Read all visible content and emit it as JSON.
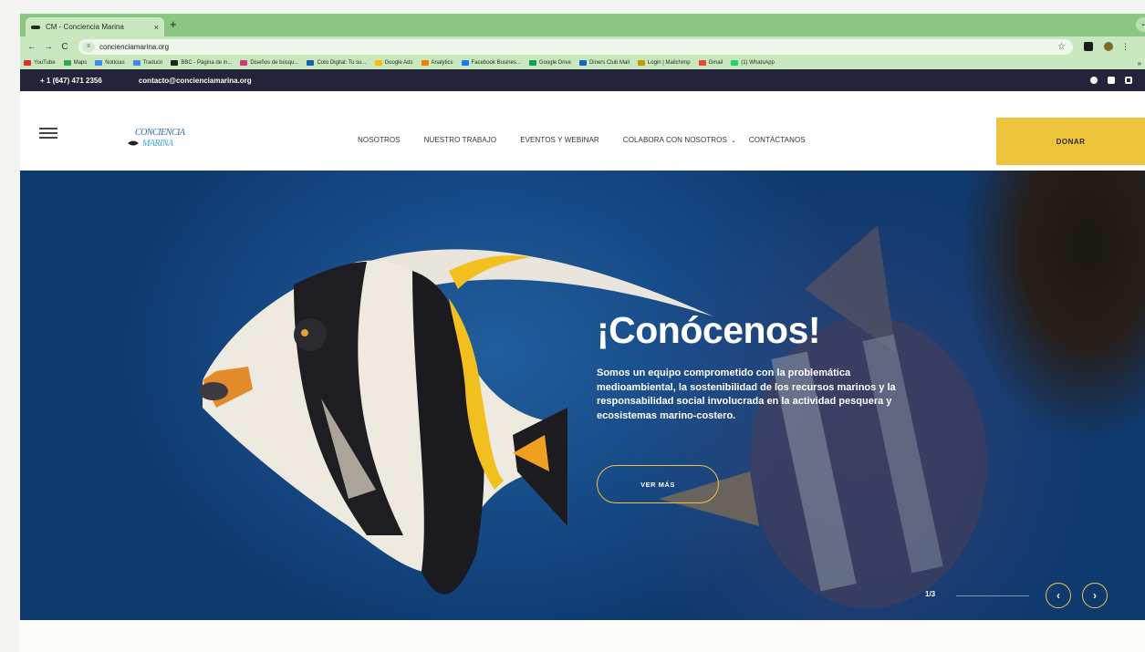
{
  "browser": {
    "tab_title": "CM - Conciencia Marina",
    "tab_close": "×",
    "new_tab": "+",
    "tab_menu": "⌄",
    "nav": {
      "back": "←",
      "forward": "→",
      "reload": "C"
    },
    "url": "concienciamarina.org",
    "site_info_icon": "≡",
    "star": "☆",
    "more": "⋮",
    "bookmarks": [
      {
        "label": "YouTube",
        "icon": "youtube-icon",
        "color": "#e52d27"
      },
      {
        "label": "Maps",
        "icon": "maps-icon",
        "color": "#34a853"
      },
      {
        "label": "Noticias",
        "icon": "news-icon",
        "color": "#4285f4"
      },
      {
        "label": "Traducir",
        "icon": "translate-icon",
        "color": "#4285f4"
      },
      {
        "label": "BBC - Página de in...",
        "icon": "bbc-icon",
        "color": "#222222"
      },
      {
        "label": "Diseños de búsqu...",
        "icon": "design-icon",
        "color": "#d8357a"
      },
      {
        "label": "Coto Digital: Tu su...",
        "icon": "coto-icon",
        "color": "#1a5fb4"
      },
      {
        "label": "Google Ads",
        "icon": "google-ads-icon",
        "color": "#fbbc04"
      },
      {
        "label": "Analytics",
        "icon": "analytics-icon",
        "color": "#f57c00"
      },
      {
        "label": "Facebook Busines...",
        "icon": "meta-icon",
        "color": "#1877f2"
      },
      {
        "label": "Google Drive",
        "icon": "drive-icon",
        "color": "#0f9d58"
      },
      {
        "label": "Diners Club Mall",
        "icon": "diners-icon",
        "color": "#1565c0"
      },
      {
        "label": "Login | Mailchimp",
        "icon": "mailchimp-icon",
        "color": "#c79a00"
      },
      {
        "label": "Gmail",
        "icon": "gmail-icon",
        "color": "#ea4335"
      },
      {
        "label": "(1) WhatsApp",
        "icon": "whatsapp-icon",
        "color": "#25d366"
      }
    ],
    "bookmarks_more": "»"
  },
  "topbar": {
    "phone": "+ 1 (647) 471 2356",
    "email": "contacto@concienciamarina.org",
    "social": [
      "facebook-icon",
      "youtube-icon",
      "instagram-icon"
    ]
  },
  "header": {
    "logo_line1": "CONCIENCIA",
    "logo_line2": "MARINA",
    "nav": [
      {
        "label": "NOSOTROS"
      },
      {
        "label": "NUESTRO TRABAJO"
      },
      {
        "label": "EVENTOS Y WEBINAR"
      },
      {
        "label": "COLABORA CON NOSOTROS",
        "caret": "⌄"
      },
      {
        "label": "CONTÁCTANOS"
      }
    ],
    "donate_label": "DONAR"
  },
  "hero": {
    "title": "¡Conócenos!",
    "description": "Somos un equipo comprometido con la problemática medioambiental, la sostenibilidad de los recursos marinos y la responsabilidad social involucrada en la actividad pesquera y ecosistemas marino-costero.",
    "button_label": "VER MÁS",
    "slide_counter": "1/3",
    "prev": "‹",
    "next": "›"
  },
  "colors": {
    "browser_green": "#8bc782",
    "topbar": "#23243a",
    "accent_yellow": "#efc43d",
    "hero_blue": "#164a86"
  }
}
